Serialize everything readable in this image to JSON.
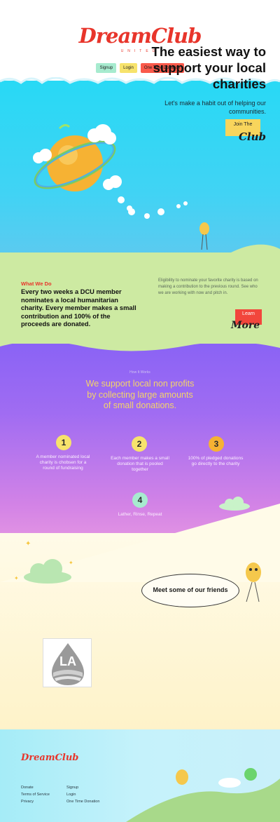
{
  "header": {
    "logo": "DreamClub",
    "logo_sub": "UNITED",
    "nav": {
      "signup": "Signup",
      "login": "Login",
      "donate": "One Time Donation"
    }
  },
  "hero": {
    "title": "The easiest way to support your local charities",
    "subtitle": "Let's make a habit out of helping our communities.",
    "cta_line1": "Join The",
    "cta_line2": "Club"
  },
  "what_we_do": {
    "label": "What We Do",
    "text": "Every two weeks a DCU member nominates a local humanitarian charity. Every member makes a small contribution and 100% of the proceeds are donated.",
    "eligibility": "Eligibility to nominate your favorite charity is based on making a contribution to the previous round. See who we are working with now and pitch in.",
    "cta_line1": "Learn",
    "cta_line2": "More"
  },
  "how_it_works": {
    "label": "How It Works",
    "title": "We support local non profits by collecting large amounts of small donations.",
    "steps": [
      {
        "num": "1",
        "text": "A member nominated local charity is chobsen for a round of fundraising"
      },
      {
        "num": "2",
        "text": "Each member makes a small donation that is pooled together"
      },
      {
        "num": "3",
        "text": "100% of pledged donations go directly to the charity"
      },
      {
        "num": "4",
        "text": "Lather, Rinse, Repeat"
      }
    ]
  },
  "friends": {
    "title": "Meet some of our friends",
    "partner_logo": "LA"
  },
  "footer": {
    "logo": "DreamClub",
    "links_left": [
      "Donate",
      "Terms of Service",
      "Privacy"
    ],
    "links_right": [
      "Signup",
      "Login",
      "One Time Donation"
    ]
  },
  "colors": {
    "brand_red": "#e8352b",
    "sky": "#28d9f5",
    "purple": "#8a63f5",
    "yellow": "#f7e36c",
    "mint": "#a7ebcf"
  }
}
